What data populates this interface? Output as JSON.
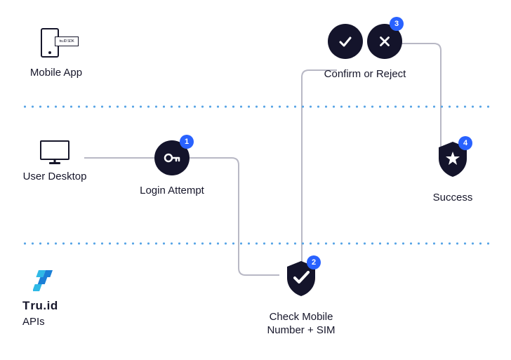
{
  "lanes": {
    "top_label": "Mobile App",
    "middle_label_left": "User Desktop",
    "bottom_brand": "tru.id",
    "bottom_label": "APIs"
  },
  "sdk_card_text": "tru.ID SDK",
  "steps": {
    "login": {
      "num": "1",
      "label": "Login Attempt"
    },
    "check": {
      "num": "2",
      "label_line1": "Check Mobile",
      "label_line2": "Number + SIM"
    },
    "confirm": {
      "num": "3",
      "label": "Confirm or Reject"
    },
    "success": {
      "num": "4",
      "label": "Success"
    }
  }
}
